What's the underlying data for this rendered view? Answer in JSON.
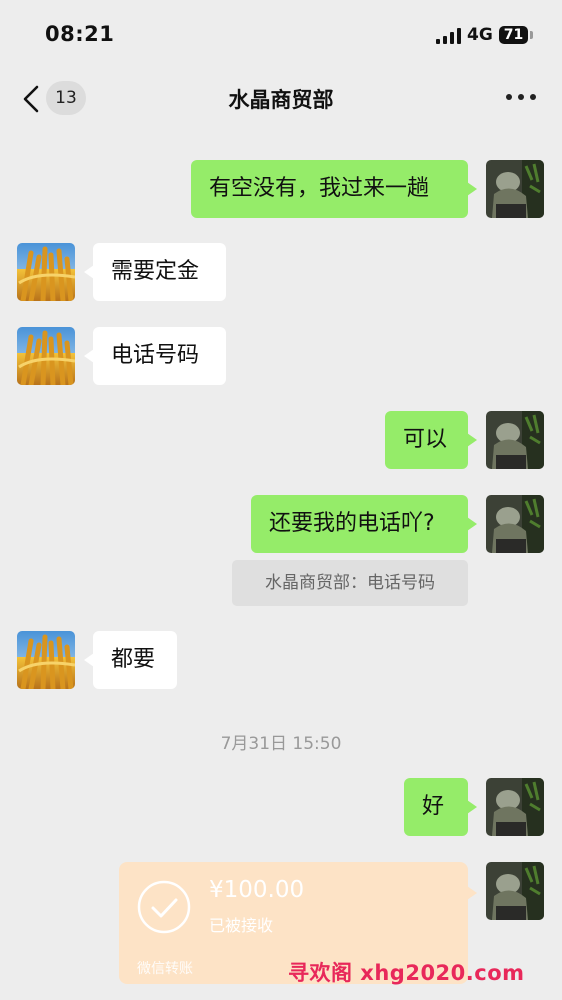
{
  "status_bar": {
    "time": "08:21",
    "network": "4G",
    "battery": "71"
  },
  "nav": {
    "unread_count": "13",
    "title": "水晶商贸部"
  },
  "messages": {
    "m1": "有空没有，我过来一趟",
    "m2": "需要定金",
    "m3": "电话号码",
    "m4": "可以",
    "m5": "还要我的电话吖?",
    "quote": "水晶商贸部：电话号码",
    "m6": "都要",
    "timestamp": "7月31日 15:50",
    "m7": "好"
  },
  "transfer": {
    "amount": "¥100.00",
    "status": "已被接收",
    "label": "微信转账"
  },
  "watermark": "寻欢阁 xhg2020.com",
  "colors": {
    "my_bubble": "#95ec69",
    "their_bubble": "#ffffff",
    "background": "#ededed",
    "transfer_card": "#fde3c6",
    "watermark": "#e8285a"
  }
}
